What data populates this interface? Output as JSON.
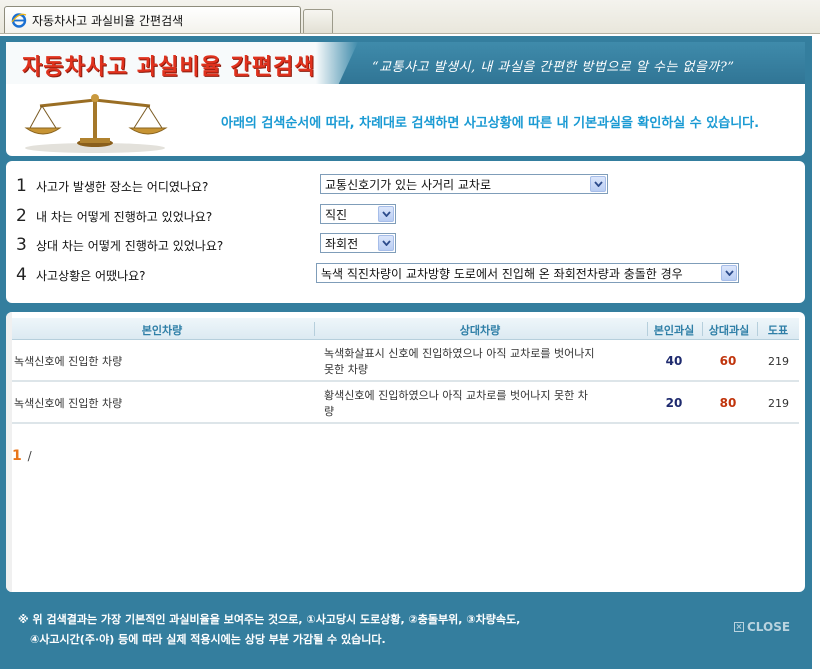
{
  "browser": {
    "tab_title": "자동차사고 과실비율 간편검색"
  },
  "header": {
    "logo_title": "자동차사고 과실비율 간편검색",
    "slogan": "“교통사고 발생시, 내 과실을 간편한 방법으로 알 수는 없을까?”"
  },
  "intro": {
    "text": "아래의 검색순서에 따라, 차례대로 검색하면 사고상황에 따른 내 기본과실을 확인하실 수 있습니다."
  },
  "questions": [
    {
      "num": "1",
      "label": "사고가 발생한 장소는 어디였나요?",
      "selected": "교통신호기가 있는 사거리 교차로"
    },
    {
      "num": "2",
      "label": "내 차는 어떻게 진행하고 있었나요?",
      "selected": "직진"
    },
    {
      "num": "3",
      "label": "상대 차는 어떻게 진행하고 있었나요?",
      "selected": "좌회전"
    },
    {
      "num": "4",
      "label": "사고상황은 어땠나요?",
      "selected": "녹색 직진차량이 교차방향 도로에서 진입해 온 좌회전차량과 충돌한 경우"
    }
  ],
  "results": {
    "headers": [
      "본인차량",
      "상대차량",
      "본인과실",
      "상대과실",
      "도표"
    ],
    "rows": [
      {
        "mine": "녹색신호에 진입한 차량",
        "other_line1": "녹색화살표시 신호에 진입하였으나 아직 교차로를 벗어나지",
        "other_line2": "못한 차량",
        "my_fault": "40",
        "other_fault": "60",
        "chart": "219"
      },
      {
        "mine": "녹색신호에 진입한 차량",
        "other_line1": "황색신호에 진입하였으나 아직 교차로를 벗어나지 못한 차",
        "other_line2": "량",
        "my_fault": "20",
        "other_fault": "80",
        "chart": "219"
      }
    ],
    "pager_current": "1",
    "pager_sep": "/"
  },
  "footer": {
    "note_line1": "※ 위 검색결과는 가장 기본적인 과실비율을 보여주는 것으로, ①사고당시 도로상황, ②충돌부위, ③차량속도,",
    "note_line2": "④사고시간(주·야) 등에 따라 실제 적용시에는 상당 부분 가감될 수 있습니다.",
    "close_label": "CLOSE"
  },
  "colors": {
    "frame_blue": "#347e9e",
    "logo_red": "#e0321e",
    "intro_text_blue": "#1a9ad3",
    "my_fault_color": "#1e2a6e",
    "other_fault_color": "#c0340c",
    "pager_orange": "#e8751a"
  },
  "icons": [
    "ie-icon",
    "scales-of-justice-icon",
    "dropdown-arrow-icon",
    "close-box-icon"
  ]
}
